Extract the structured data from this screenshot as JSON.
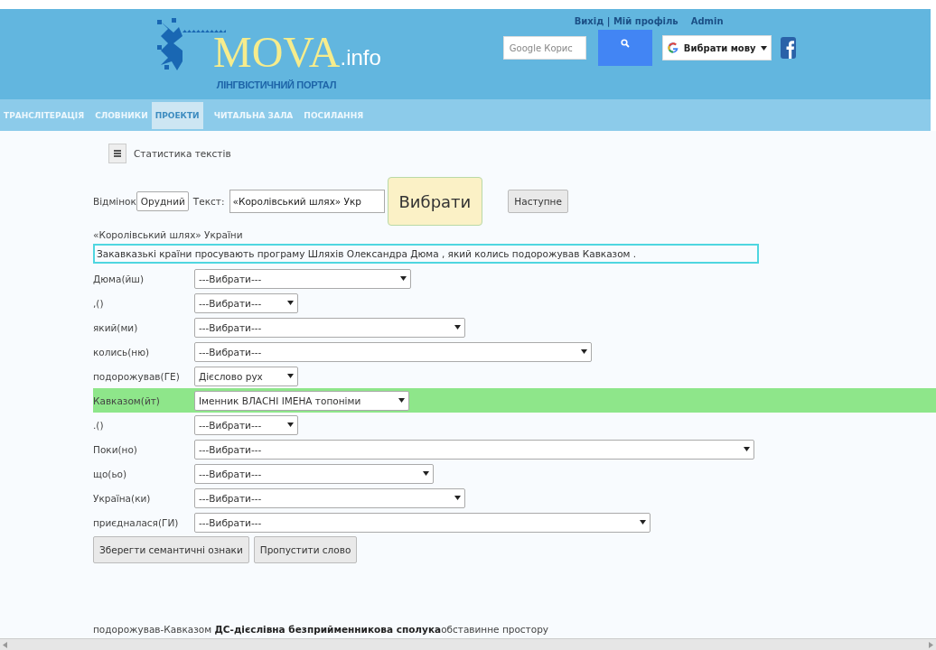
{
  "header": {
    "logo": {
      "name": "MOVA",
      "suffix": ".info",
      "tagline": "ЛІНГВІСТИЧНИЙ ПОРТАЛ"
    },
    "user_links": [
      {
        "label": "Вихід | Мій профіль"
      },
      {
        "label": "Admin"
      }
    ],
    "search": {
      "placeholder": "Google Корис"
    },
    "language": {
      "label": "Вибрати мову"
    }
  },
  "nav": [
    {
      "label": "ТРАНСЛІТЕРАЦІЯ",
      "selected": false
    },
    {
      "label": "СЛОВНИКИ",
      "selected": false
    },
    {
      "label": "ПРОЕКТИ",
      "selected": true
    },
    {
      "label": "ЧИТАЛЬНА ЗАЛА",
      "selected": false
    },
    {
      "label": "ПОСИЛАННЯ",
      "selected": false
    }
  ],
  "page_title": "Статистика текстів",
  "form": {
    "case_label": "Відмінок",
    "case_value": "Орудний",
    "text_label": "Текст:",
    "text_value": "«Королівський шлях» Укр",
    "choose_button": "Вибрати",
    "next_button": "Наступне"
  },
  "text_title": "«Королівський шлях» України",
  "sentence": "Закавказькі країни просувають програму Шляхів Олександра Дюма , який колись подорожував Кавказом .",
  "words": [
    {
      "label": "Дюма(йш)",
      "value": "---Вибрати---",
      "highlighted": false
    },
    {
      "label": ",()",
      "value": "---Вибрати---",
      "highlighted": false
    },
    {
      "label": "який(ми)",
      "value": "---Вибрати---",
      "highlighted": false
    },
    {
      "label": "колись(ню)",
      "value": "---Вибрати---",
      "highlighted": false
    },
    {
      "label": "подорожував(ГЕ)",
      "value": "Дієслово рух",
      "highlighted": false
    },
    {
      "label": "Кавказом(йт)",
      "value": "Іменник ВЛАСНІ ІМЕНА топоніми",
      "highlighted": true
    },
    {
      "label": ".()",
      "value": "---Вибрати---",
      "highlighted": false
    },
    {
      "label": "Поки(но)",
      "value": "---Вибрати---",
      "highlighted": false
    },
    {
      "label": "що(ьо)",
      "value": "---Вибрати---",
      "highlighted": false
    },
    {
      "label": "Україна(ки)",
      "value": "---Вибрати---",
      "highlighted": false
    },
    {
      "label": "приєдналася(ГИ)",
      "value": "---Вибрати---",
      "highlighted": false
    }
  ],
  "actions": [
    "Зберегти семантичні ознаки",
    "Пропустити слово"
  ],
  "result": "подорожував-Кавказом **ДС-дієслівна безприйменникова сполука**обставинне простору"
}
